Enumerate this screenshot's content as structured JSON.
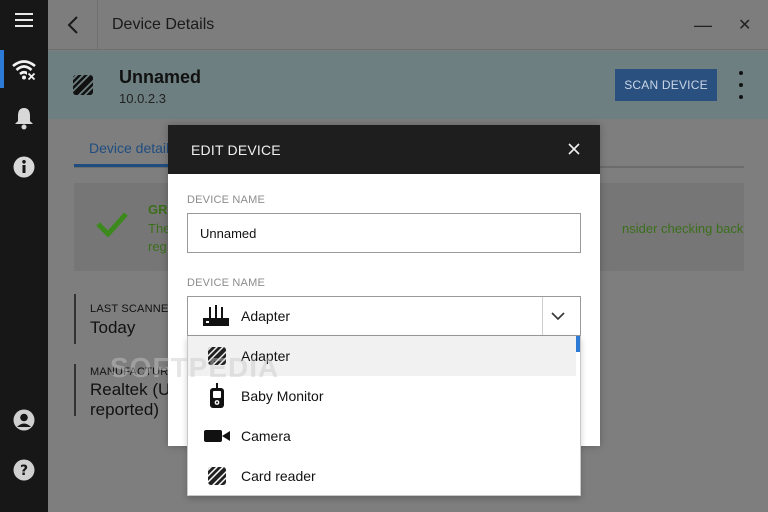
{
  "window": {
    "title": "Device Details",
    "minimize_glyph": "—",
    "close_glyph": "✕"
  },
  "rail": {
    "items": [
      {
        "name": "menu-icon"
      },
      {
        "name": "wifi-network-icon",
        "active": true
      },
      {
        "name": "bell-icon"
      },
      {
        "name": "info-icon"
      },
      {
        "name": "account-icon"
      },
      {
        "name": "help-icon"
      }
    ],
    "accent": "#2b7bd6"
  },
  "device": {
    "name": "Unnamed",
    "ip": "10.0.2.3",
    "scan_label": "SCAN DEVICE"
  },
  "tabs": {
    "active_label": "Device detail"
  },
  "status": {
    "heading": "GR",
    "line1": "The",
    "line2": "reg",
    "line_right": "nsider checking back",
    "color": "#3c6f1c"
  },
  "details": {
    "last_scanned_label": "LAST SCANNED",
    "last_scanned_value": "Today",
    "manufacturer_label": "MANUFACTUR",
    "manufacturer_line1": "Realtek (Up",
    "manufacturer_line2": "reported)"
  },
  "modal": {
    "title": "EDIT DEVICE",
    "name_label": "DEVICE NAME",
    "name_value": "Unnamed",
    "type_label": "DEVICE NAME",
    "selected_type": "Adapter",
    "options": [
      {
        "label": "Adapter",
        "icon": "adapter-icon",
        "selected": true
      },
      {
        "label": "Baby Monitor",
        "icon": "baby-monitor-icon",
        "selected": false
      },
      {
        "label": "Camera",
        "icon": "camera-icon",
        "selected": false
      },
      {
        "label": "Card reader",
        "icon": "card-reader-icon",
        "selected": false
      }
    ]
  },
  "watermark": "SOFTPEDIA"
}
